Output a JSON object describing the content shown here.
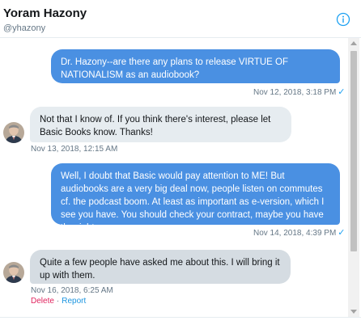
{
  "header": {
    "name": "Yoram Hazony",
    "handle": "@yhazony",
    "info_icon": "info-circle-icon"
  },
  "colors": {
    "sent_bubble": "#4a90e2",
    "received_bubble": "#e6ecf0",
    "delete": "#e0245e",
    "link": "#1b95e0"
  },
  "messages": [
    {
      "direction": "sent",
      "text": "Dr. Hazony--are there any plans to release VIRTUE OF NATIONALISM as an audiobook?",
      "timestamp": "Nov 12, 2018, 3:18 PM",
      "read_icon": "checkmark-icon"
    },
    {
      "direction": "received",
      "text": "Not that I know of. If you think there's interest, please let Basic Books know. Thanks!",
      "timestamp": "Nov 13, 2018, 12:15 AM"
    },
    {
      "direction": "sent",
      "text": "Well, I doubt that Basic would pay attention to ME! But audiobooks are a very big deal now, people listen on commutes cf. the podcast boom. At least as important as e-version, which I see you have. You should check your contract, maybe you have the rights.",
      "timestamp": "Nov 14, 2018, 4:39 PM",
      "read_icon": "checkmark-icon"
    },
    {
      "direction": "received",
      "text": "Quite a few people have asked me about this. I will bring it up with them.",
      "timestamp": "Nov 16, 2018, 6:25 AM",
      "actions": {
        "delete": "Delete",
        "separator": "·",
        "report": "Report"
      }
    }
  ],
  "check_glyph": "✓"
}
